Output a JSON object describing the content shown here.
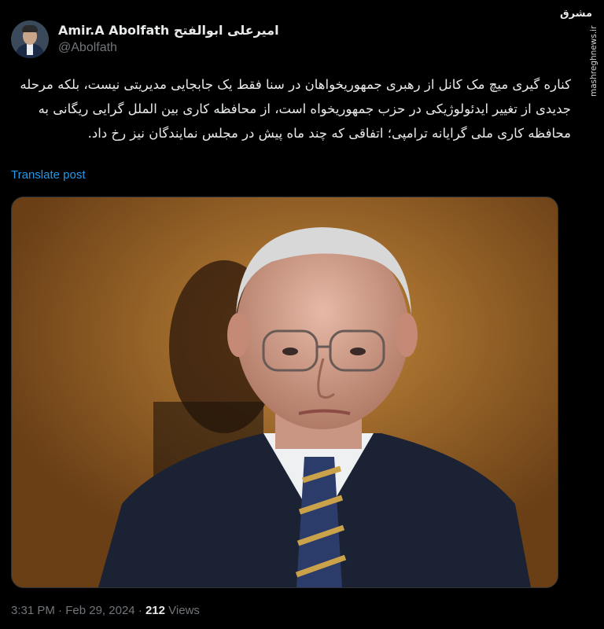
{
  "watermark": {
    "site": "mashreghnews.ir",
    "logo_text": "مشرق"
  },
  "author": {
    "display_name": "Amir.A Abolfath امیرعلی ابوالفتح",
    "handle": "@Abolfath"
  },
  "tweet": {
    "text": "کناره گیری میچ مک کانل از رهبری جمهوریخواهان در سنا فقط یک جابجایی مدیریتی نیست، بلکه مرحله جدیدی از تغییر ایدئولوژیکی در حزب جمهوریخواه است، از محافظه کاری بین الملل گرایی ریگانی به محافظه کاری ملی گرایانه ترامپی؛ اتفاقی که چند ماه پیش در مجلس نمایندگان نیز رخ داد.",
    "translate_label": "Translate post"
  },
  "meta": {
    "time": "3:31 PM",
    "separator": "·",
    "date": "Feb 29, 2024",
    "views_count": "212",
    "views_label": "Views"
  },
  "colors": {
    "background": "#000000",
    "text": "#e7e9ea",
    "muted": "#71767b",
    "link": "#1d9bf0"
  }
}
